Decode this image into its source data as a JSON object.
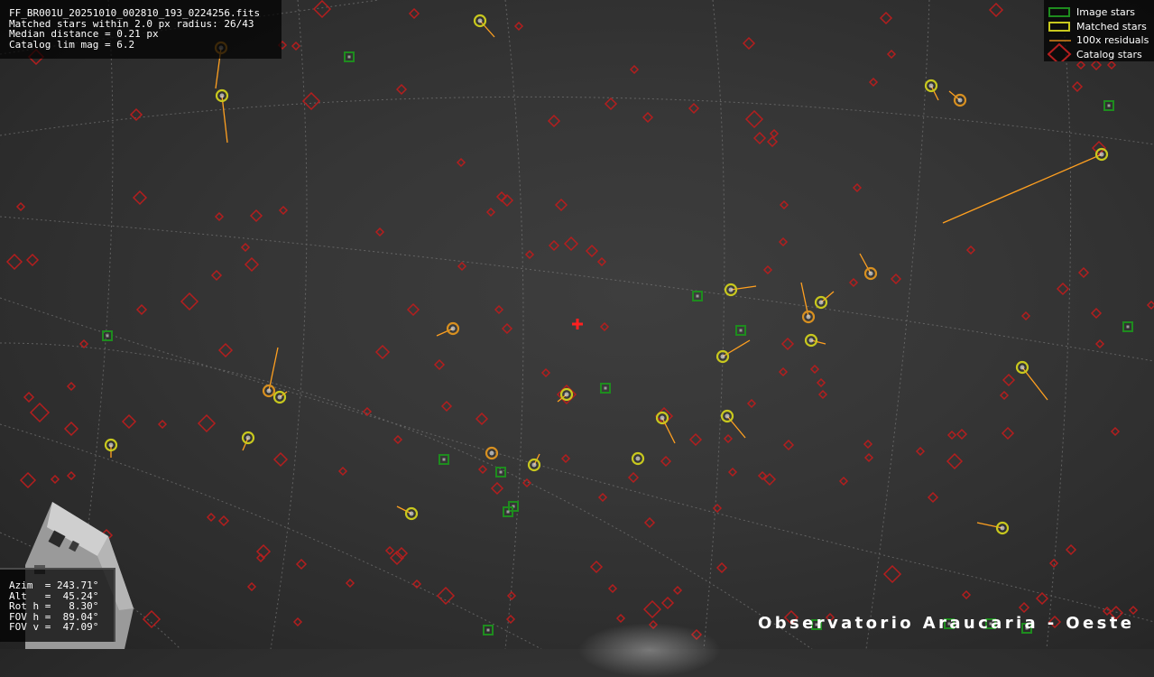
{
  "header": {
    "filename": "FF_BR001U_20251010_002810_193_0224256.fits",
    "matched_line": "Matched stars within 2.0 px radius: 26/43",
    "median_line": "Median distance = 0.21 px",
    "catalog_line": "Catalog lim mag = 6.2"
  },
  "legend": {
    "image_stars": "Image stars",
    "matched_stars": "Matched stars",
    "residuals": "100x residuals",
    "catalog_stars": "Catalog stars"
  },
  "pointing": {
    "azim": "Azim  = 243.71°",
    "alt": "Alt   =  45.24°",
    "rot": "Rot h =   8.30°",
    "fov_h": "FOV h =  89.04°",
    "fov_v": "FOV v =  47.09°"
  },
  "watermark": "Observatorio Araucaria - Oeste",
  "colors": {
    "image_star": "#1e8c1e",
    "matched_star": "#c8c81e",
    "residual": "#ffa020",
    "catalog_star": "#b41e1e",
    "grid": "#8a8a8a",
    "center_marker": "#ff2020"
  },
  "icons": {
    "center": "red-cross-icon",
    "image_star": "green-square-icon",
    "matched_star": "yellow-circle-icon",
    "catalog_star": "red-diamond-icon"
  }
}
